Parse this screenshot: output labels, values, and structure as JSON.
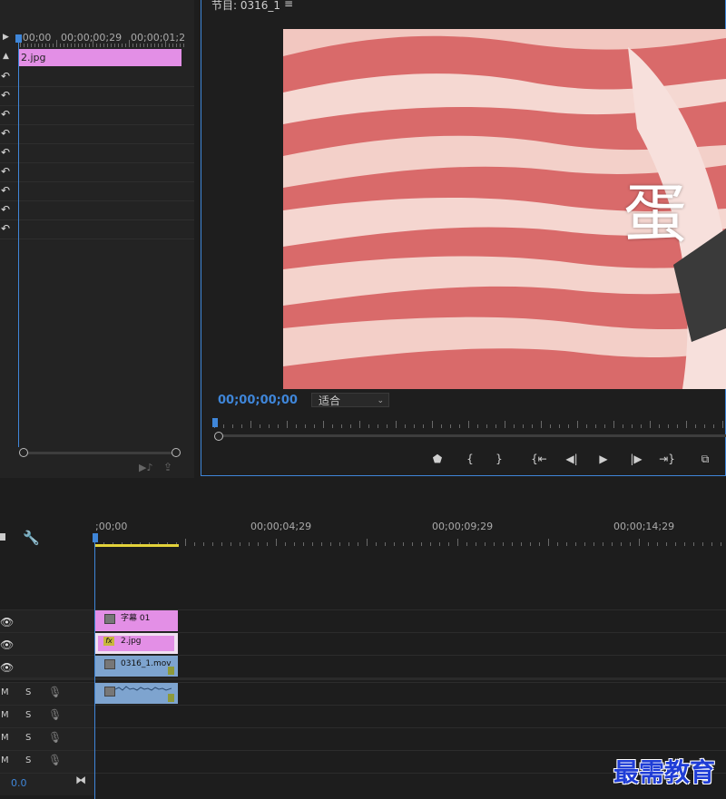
{
  "source_panel": {
    "timecodes": [
      ";00;00",
      "00;00;00;29",
      "00;00;01;2"
    ],
    "clip_label": "2.jpg"
  },
  "program_monitor": {
    "title": "节目: 0316_1",
    "menu_icon": "hamburger-icon",
    "caption": "蛋",
    "timecode": "00;00;00;00",
    "fit_value": "适合",
    "transport_icons": [
      "marker-icon",
      "mark-in-icon",
      "mark-out-icon",
      "go-to-in-icon",
      "step-back-icon",
      "play-icon",
      "step-forward-icon",
      "go-to-out-icon",
      "export-frame-icon"
    ]
  },
  "timeline": {
    "ruler": [
      ";00;00",
      "00;00;04;29",
      "00;00;09;29",
      "00;00;14;29"
    ],
    "tracks": {
      "v3": {
        "clip": "字幕 01"
      },
      "v2": {
        "clip": "2.jpg",
        "fx": "fx"
      },
      "v1": {
        "clip": "0316_1.mov"
      }
    },
    "audio_labels": {
      "m": "M",
      "s": "S"
    },
    "bottom_value": "0.0"
  },
  "watermark": "最需教育",
  "colors": {
    "accent": "#3f86d9",
    "pink_clip": "#e38fe6",
    "blue_clip": "#7ea4cf",
    "workbar": "#e3d23a"
  }
}
